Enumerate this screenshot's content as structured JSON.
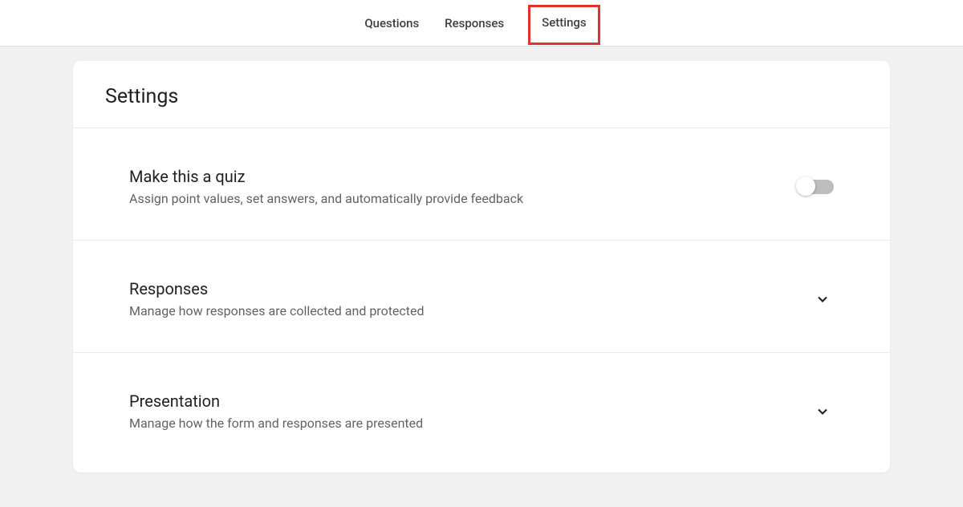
{
  "tabs": {
    "questions": "Questions",
    "responses": "Responses",
    "settings": "Settings"
  },
  "page": {
    "title": "Settings"
  },
  "sections": {
    "quiz": {
      "title": "Make this a quiz",
      "desc": "Assign point values, set answers, and automatically provide feedback",
      "toggle_on": false
    },
    "responses": {
      "title": "Responses",
      "desc": "Manage how responses are collected and protected"
    },
    "presentation": {
      "title": "Presentation",
      "desc": "Manage how the form and responses are presented"
    }
  }
}
